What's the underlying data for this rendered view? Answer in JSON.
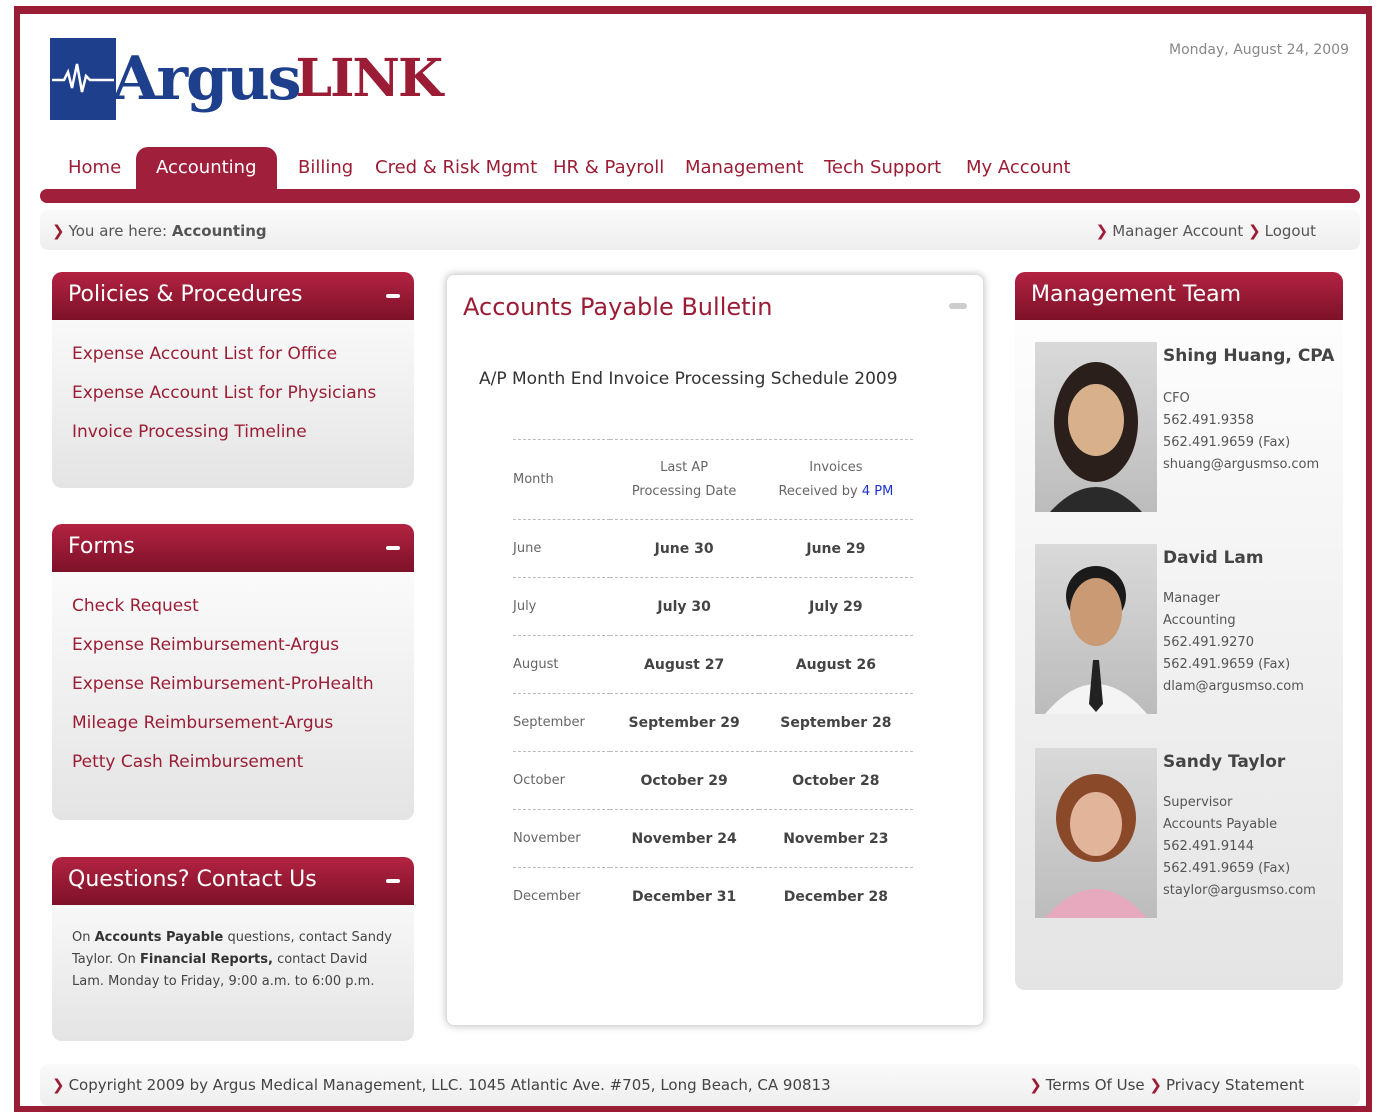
{
  "header": {
    "logo_argus": "Argus",
    "logo_link": "LINK",
    "date": "Monday, August 24, 2009"
  },
  "nav": {
    "items": [
      "Home",
      "Accounting",
      "Billing",
      "Cred & Risk Mgmt",
      "HR & Payroll",
      "Management",
      "Tech Support",
      "My Account"
    ],
    "active": "Accounting"
  },
  "breadcrumb": {
    "prefix": "You are here:",
    "current": "Accounting",
    "manager_account": "Manager Account",
    "logout": "Logout"
  },
  "policies": {
    "title": "Policies & Procedures",
    "links": [
      "Expense Account List for Office",
      "Expense Account List for Physicians",
      "Invoice Processing Timeline"
    ]
  },
  "forms": {
    "title": "Forms",
    "links": [
      "Check Request",
      "Expense Reimbursement-Argus",
      "Expense Reimbursement-ProHealth",
      "Mileage Reimbursement-Argus",
      "Petty Cash Reimbursement"
    ]
  },
  "contact": {
    "title": "Questions? Contact Us",
    "text_1": "On ",
    "bold_1": "Accounts Payable",
    "text_2": " questions, contact Sandy Taylor. On ",
    "bold_2": "Financial Reports,",
    "text_3": " contact David Lam. Monday to Friday, 9:00 a.m. to 6:00 p.m."
  },
  "bulletin": {
    "title": "Accounts Payable Bulletin",
    "subtitle": "A/P Month End Invoice Processing Schedule 2009",
    "col_month": "Month",
    "col_last_ap_1": "Last AP",
    "col_last_ap_2": "Processing Date",
    "col_invoices_1": "Invoices",
    "col_invoices_2": "Received by",
    "col_invoices_time": "4 PM",
    "rows": [
      {
        "month": "June",
        "last": "June 30",
        "received": "June 29"
      },
      {
        "month": "July",
        "last": "July 30",
        "received": "July 29"
      },
      {
        "month": "August",
        "last": "August 27",
        "received": "August 26"
      },
      {
        "month": "September",
        "last": "September 29",
        "received": "September 28"
      },
      {
        "month": "October",
        "last": "October 29",
        "received": "October 28"
      },
      {
        "month": "November",
        "last": "November 24",
        "received": "November 23"
      },
      {
        "month": "December",
        "last": "December 31",
        "received": "December 28"
      }
    ]
  },
  "team": {
    "title": "Management Team",
    "members": [
      {
        "name": "Shing Huang, CPA",
        "lines": [
          "CFO",
          "562.491.9358",
          "562.491.9659 (Fax)",
          "shuang@argusmso.com"
        ]
      },
      {
        "name": "David Lam",
        "lines": [
          "Manager",
          "Accounting",
          "562.491.9270",
          "562.491.9659 (Fax)",
          "dlam@argusmso.com"
        ]
      },
      {
        "name": "Sandy Taylor",
        "lines": [
          "Supervisor",
          "Accounts Payable",
          "562.491.9144",
          "562.491.9659 (Fax)",
          "staylor@argusmso.com"
        ]
      }
    ]
  },
  "footer": {
    "copyright": "Copyright 2009 by Argus Medical Management, LLC. 1045 Atlantic Ave. #705, Long Beach, CA 90813",
    "terms": "Terms Of Use",
    "privacy": "Privacy Statement"
  },
  "colors": {
    "brand_red": "#9b1d35",
    "brand_blue": "#1e3f8c",
    "link_blue": "#1c32c8"
  }
}
